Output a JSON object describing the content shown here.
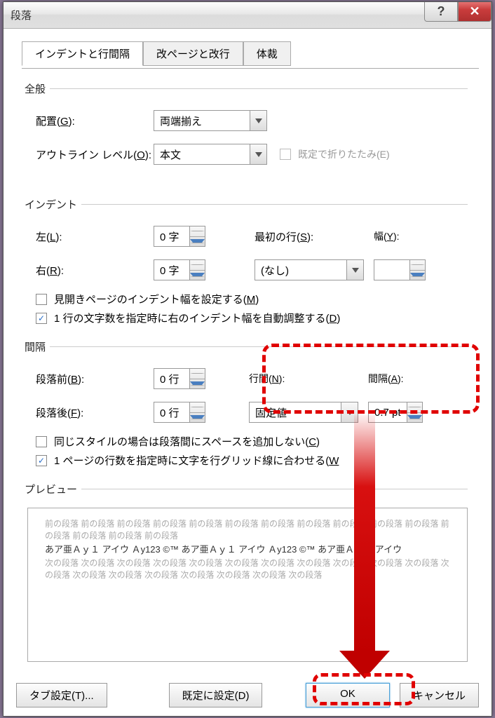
{
  "title": "段落",
  "tabs": [
    "インデントと行間隔",
    "改ページと改行",
    "体裁"
  ],
  "general": {
    "legend": "全般",
    "align_label": "配置(G):",
    "align_value": "両端揃え",
    "outline_label": "アウトライン レベル(O):",
    "outline_value": "本文",
    "collapse_label": "既定で折りたたみ(E)"
  },
  "indent": {
    "legend": "インデント",
    "left_label": "左(L):",
    "left_value": "0 字",
    "right_label": "右(R):",
    "right_value": "0 字",
    "firstline_label": "最初の行(S):",
    "firstline_value": "(なし)",
    "width_label": "幅(Y):",
    "width_value": "",
    "mirror": "見開きページのインデント幅を設定する(M)",
    "autoadjust": "1 行の文字数を指定時に右のインデント幅を自動調整する(D)"
  },
  "spacing": {
    "legend": "間隔",
    "before_label": "段落前(B):",
    "before_value": "0 行",
    "after_label": "段落後(F):",
    "after_value": "0 行",
    "line_label": "行間(N):",
    "line_value": "固定値",
    "at_label": "間隔(A):",
    "at_value": "0.7 pt",
    "nospace": "同じスタイルの場合は段落間にスペースを追加しない(C)",
    "snapgrid": "1 ページの行数を指定時に文字を行グリッド線に合わせる(W"
  },
  "preview": {
    "legend": "プレビュー",
    "before_para": "前の段落 前の段落 前の段落 前の段落 前の段落 前の段落 前の段落 前の段落 前の段落 前の段落 前の段落 前の段落 前の段落 前の段落 前の段落",
    "sample": "あア亜Ａｙ１ アイウ Ａy123 ©™ あア亜Ａｙ１ アイウ Ａy123 ©™ あア亜Ａｙ１ アイウ",
    "after_para": "次の段落 次の段落 次の段落 次の段落 次の段落 次の段落 次の段落 次の段落 次の段落 次の段落 次の段落 次の段落 次の段落 次の段落 次の段落 次の段落 次の段落 次の段落 次の段落"
  },
  "buttons": {
    "tabs": "タブ設定(T)...",
    "default": "既定に設定(D)",
    "ok": "OK",
    "cancel": "キャンセル"
  }
}
